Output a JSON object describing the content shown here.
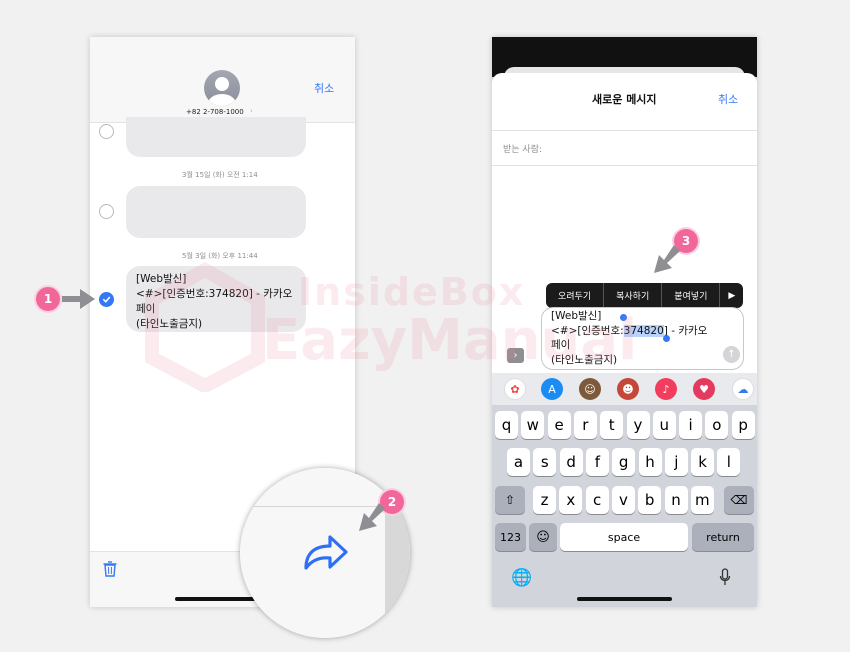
{
  "left": {
    "contact_number": "+82 2-708-1000",
    "cancel": "취소",
    "timestamp1": "3월 15일 (화) 오전 1:14",
    "timestamp2": "5월 3일 (화) 오후 11:44",
    "message": "[Web발신]\n<#>[인증번호:374820] - 카카오\n페이\n(타인노출금지)"
  },
  "right": {
    "title": "새로운 메시지",
    "cancel": "취소",
    "to_label": "받는 사람:",
    "menu": [
      "오려두기",
      "복사하기",
      "붙여넣기"
    ],
    "compose_line1": "[Web발신]",
    "compose_line2_pre": "<#>[인증번호:",
    "compose_line2_sel": "374820",
    "compose_line2_post": "] - 카카오",
    "compose_line3": "페이",
    "compose_line4": "(타인노출금지)",
    "keys_row1": [
      "q",
      "w",
      "e",
      "r",
      "t",
      "y",
      "u",
      "i",
      "o",
      "p"
    ],
    "keys_row2": [
      "a",
      "s",
      "d",
      "f",
      "g",
      "h",
      "j",
      "k",
      "l"
    ],
    "keys_row3": [
      "z",
      "x",
      "c",
      "v",
      "b",
      "n",
      "m"
    ],
    "key_123": "123",
    "key_space": "space",
    "key_return": "return"
  },
  "steps": [
    "1",
    "2",
    "3"
  ],
  "watermark": [
    "InsideBox",
    "EazyManual"
  ],
  "colors": {
    "accent": "#3478f6",
    "step": "#f2679a"
  }
}
